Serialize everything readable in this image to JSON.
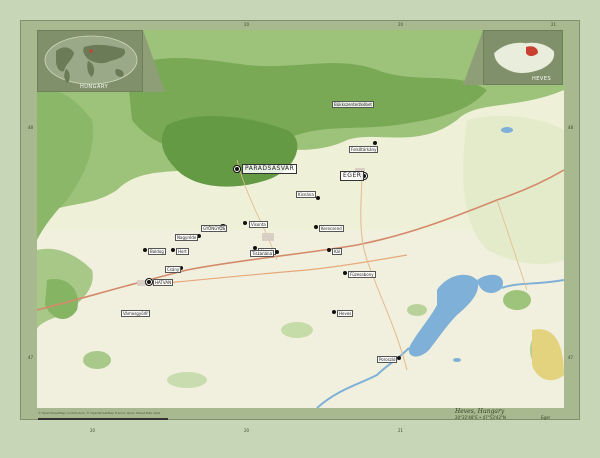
{
  "region": {
    "name": "Heves, Hungary",
    "capital_label": "Eger",
    "coordinates": "20°22'48\"E  •  47°53'42\"N"
  },
  "insets": {
    "world_label": "HUNGARY",
    "country_label": "HEVES",
    "hungary_side_label": "HUNGARY"
  },
  "places": [
    {
      "id": "parad",
      "label": "PARÁDSASVÁR",
      "major": true
    },
    {
      "id": "eger",
      "label": "EGER",
      "major": true
    },
    {
      "id": "gyongyos",
      "label": "GYÖNGYÖS",
      "major": true
    },
    {
      "id": "hatvan",
      "label": "HATVAN",
      "major": true
    },
    {
      "id": "bukkszenterzsebet",
      "label": "Bükkszenterzsébet"
    },
    {
      "id": "felsotarkany",
      "label": "Felsőtárkány"
    },
    {
      "id": "nagyreode",
      "label": "Nagyréde"
    },
    {
      "id": "visonta",
      "label": "Visonta"
    },
    {
      "id": "abasar",
      "label": "Abasár"
    },
    {
      "id": "kal",
      "label": "Kál"
    },
    {
      "id": "fuzesabony",
      "label": "Füzesabony"
    },
    {
      "id": "heves",
      "label": "Heves"
    },
    {
      "id": "kisnana",
      "label": "Kisnána"
    },
    {
      "id": "boldog",
      "label": "Boldog"
    },
    {
      "id": "hort",
      "label": "Hort"
    },
    {
      "id": "csany",
      "label": "Csány"
    },
    {
      "id": "poroszlo",
      "label": "Poroszló"
    },
    {
      "id": "vamosgyork",
      "label": "Vámosgyörk"
    },
    {
      "id": "kerecsend",
      "label": "Kerecsend"
    },
    {
      "id": "tiszanana",
      "label": "Tiszanána"
    }
  ],
  "ticks": {
    "top": [
      "20",
      "20",
      "21"
    ],
    "left": [
      "48",
      "47"
    ],
    "right": [
      "48",
      "47"
    ],
    "bottom": [
      "20",
      "20",
      "21"
    ]
  },
  "footer": {
    "attribution": "© OpenStreetMap contributors, © OpenStreetMap France; Open Street Map style"
  },
  "colors": {
    "forest": "#7fae5a",
    "dense_forest": "#5f9440",
    "field": "#e7eacc",
    "water": "#7fb0d8",
    "road": "#d48a6a",
    "frame": "#a8b990"
  }
}
